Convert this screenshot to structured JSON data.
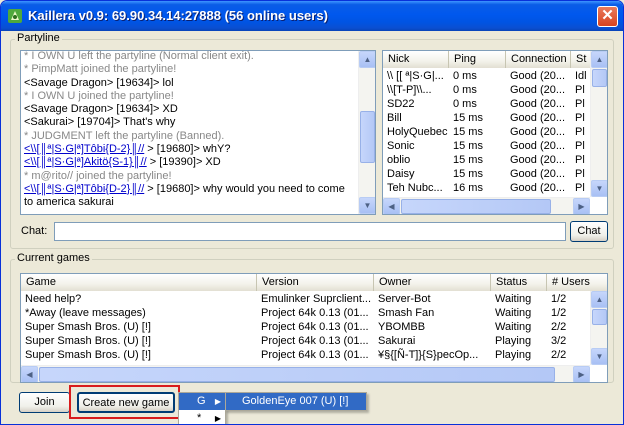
{
  "window": {
    "title": "Kaillera v0.9: 69.90.34.14:27888 (56 online users)",
    "close_glyph": "✕"
  },
  "partyline": {
    "label": "Partyline",
    "messages": [
      {
        "text": "* I OWN U left the partyline (Normal client exit).",
        "kind": "sys"
      },
      {
        "text": "* PimpMatt joined the partyline!",
        "kind": "sys"
      },
      {
        "text": "<Savage Dragon> [19634]> lol",
        "kind": "msg"
      },
      {
        "text": "* I OWN U joined the partyline!",
        "kind": "sys"
      },
      {
        "text": "<Savage Dragon> [19634]> XD",
        "kind": "msg"
      },
      {
        "text": "<Sakurai> [19704]> That's why",
        "kind": "msg"
      },
      {
        "text": "* JUDGMENT left the partyline (Banned).",
        "kind": "sys"
      },
      {
        "prefix": "<",
        "name": "\\\\[║ª|S·G|ª]Tôbi{D-2}║//",
        "suffix": " > [19680]> whY?",
        "kind": "named"
      },
      {
        "prefix": "<",
        "name": "\\\\[║ª|S·G|ª]Akitö{S-1}║//",
        "suffix": " > [19390]> XD",
        "kind": "named"
      },
      {
        "text": "* m@rito// joined the partyline!",
        "kind": "sys"
      },
      {
        "prefix": "<",
        "name": "\\\\[║ª|S·G|ª]Tôbi{D-2}║//",
        "suffix": " > [19680]> why would you need to come",
        "kind": "named"
      },
      {
        "text": "to america sakurai",
        "kind": "msg"
      }
    ]
  },
  "users": {
    "columns": [
      "Nick",
      "Ping",
      "Connection",
      "St"
    ],
    "rows": [
      {
        "nick": "\\\\ [[ ª|S·G|...",
        "ping": "0 ms",
        "connection": "Good (20...",
        "status": "Idl"
      },
      {
        "nick": "\\\\[T-P]\\\\...",
        "ping": "0 ms",
        "connection": "Good (20...",
        "status": "Pl"
      },
      {
        "nick": "SD22",
        "ping": "0 ms",
        "connection": "Good (20...",
        "status": "Pl"
      },
      {
        "nick": "Bill",
        "ping": "15 ms",
        "connection": "Good (20...",
        "status": "Pl"
      },
      {
        "nick": "HolyQuebec",
        "ping": "15 ms",
        "connection": "Good (20...",
        "status": "Pl"
      },
      {
        "nick": "Sonic",
        "ping": "15 ms",
        "connection": "Good (20...",
        "status": "Pl"
      },
      {
        "nick": "oblio",
        "ping": "15 ms",
        "connection": "Good (20...",
        "status": "Pl"
      },
      {
        "nick": "Daisy",
        "ping": "15 ms",
        "connection": "Good (20...",
        "status": "Pl"
      },
      {
        "nick": "Teh Nubc...",
        "ping": "16 ms",
        "connection": "Good (20...",
        "status": "Pl"
      }
    ]
  },
  "chat": {
    "label": "Chat:",
    "value": "",
    "button_label": "Chat"
  },
  "games": {
    "label": "Current games",
    "columns": [
      "Game",
      "Version",
      "Owner",
      "Status",
      "# Users"
    ],
    "rows": [
      {
        "game": "Need help?",
        "version": "Emulinker Suprclient...",
        "owner": "Server-Bot",
        "status": "Waiting",
        "users": "1/2"
      },
      {
        "game": "*Away (leave messages)",
        "version": "Project 64k 0.13 (01...",
        "owner": "Smash Fan",
        "status": "Waiting",
        "users": "1/2"
      },
      {
        "game": "Super Smash Bros. (U) [!]",
        "version": "Project 64k 0.13 (01...",
        "owner": "YBOMBB",
        "status": "Waiting",
        "users": "2/2"
      },
      {
        "game": "Super Smash Bros. (U) [!]",
        "version": "Project 64k 0.13 (01...",
        "owner": "Sakurai",
        "status": "Playing",
        "users": "3/2"
      },
      {
        "game": "Super Smash Bros. (U) [!]",
        "version": "Project 64k 0.13 (01...",
        "owner": "¥§{[Ñ-T]}{S}pecOp...",
        "status": "Playing",
        "users": "2/2"
      }
    ]
  },
  "buttons": {
    "join": "Join",
    "create": "Create new game"
  },
  "menu": {
    "items": [
      "G",
      "*"
    ],
    "submenu_item": "GoldenEye 007 (U) [!]"
  }
}
